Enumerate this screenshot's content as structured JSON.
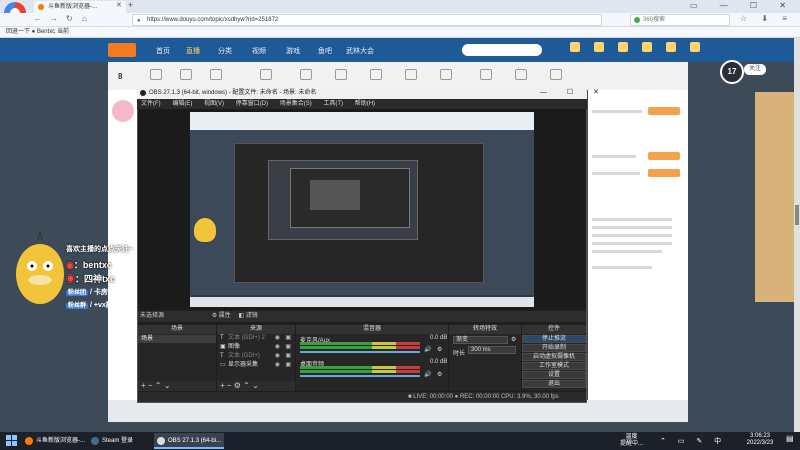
{
  "browser": {
    "tab_title": "斗鱼新版浏览器-...",
    "tab_close": "✕",
    "new_tab": "+",
    "url": "https://www.douyu.com/topic/xsdhyw?rid=251872",
    "search_engine": "360搜索",
    "bookmarks": "回退一下  ●  Bentxc 当前",
    "nav_back": "←",
    "nav_forward": "→",
    "nav_reload": "↻",
    "nav_home": "⌂",
    "window_controls": "▭ — ☐ ✕"
  },
  "site": {
    "nav": [
      "首页",
      "直播",
      "分类",
      "视频",
      "游戏",
      "鱼吧",
      "武林大会"
    ],
    "avatar_text": "17",
    "avatar_badge": "关注",
    "left_count": "8"
  },
  "overlay": {
    "title": "喜欢主播的点点关注~",
    "line1": "：bentxc",
    "line2": "：四神txc",
    "badge1": "粉丝团",
    "line3": "/ 卡房管",
    "badge2": "粉丝群",
    "line4": "/ +vx群"
  },
  "obs": {
    "title": "OBS 27.1.3 (64-bit, windows) - 配置文件: 未命名 - 场景: 未命名",
    "menu": [
      "文件(F)",
      "编辑(E)",
      "视图(V)",
      "停靠窗口(D)",
      "场景集合(S)",
      "工具(T)",
      "帮助(H)"
    ],
    "window_controls": "— ☐ ✕",
    "toolbar_source": "未选择源",
    "toolbar_props": "属性",
    "toolbar_filters": "滤镜",
    "docks": {
      "scenes_title": "场景",
      "scene_item": "场景",
      "sources_title": "来源",
      "sources": [
        {
          "icon": "T",
          "name": "文本 (GDI+) 2"
        },
        {
          "icon": "▣",
          "name": "图像"
        },
        {
          "icon": "T",
          "name": "文本 (GDI+)"
        },
        {
          "icon": "▭",
          "name": "显示器采集"
        }
      ],
      "mixer_title": "混音器",
      "mixer_tracks": [
        {
          "name": "麦克风/Aux",
          "db": "0.0 dB"
        },
        {
          "name": "桌面音频",
          "db": "0.0 dB"
        }
      ],
      "transition_title": "转场特效",
      "transition_value": "渐变",
      "duration_label": "时长",
      "duration_value": "300 ms",
      "controls_title": "控件",
      "controls": [
        "停止推流",
        "开始录制",
        "启动虚拟摄像机",
        "工作室模式",
        "设置",
        "退出"
      ]
    },
    "status": "■ LIVE: 00:00:00   ● REC: 00:00:00   CPU: 3.9%, 30.00 fps"
  },
  "taskbar": {
    "apps": [
      {
        "label": "斗鱼新版浏览器-...",
        "color": "#ff7a00"
      },
      {
        "label": "Steam 登录",
        "color": "#1b2838"
      },
      {
        "label": "OBS 27.1.3 (64-bi...",
        "color": "#333333"
      }
    ],
    "weather_line1": "温度",
    "weather_line2": "提醒中...",
    "tray_icons": "⌃ ▭ ✎ 中",
    "time": "3:06:23",
    "date": "2022/3/23"
  }
}
